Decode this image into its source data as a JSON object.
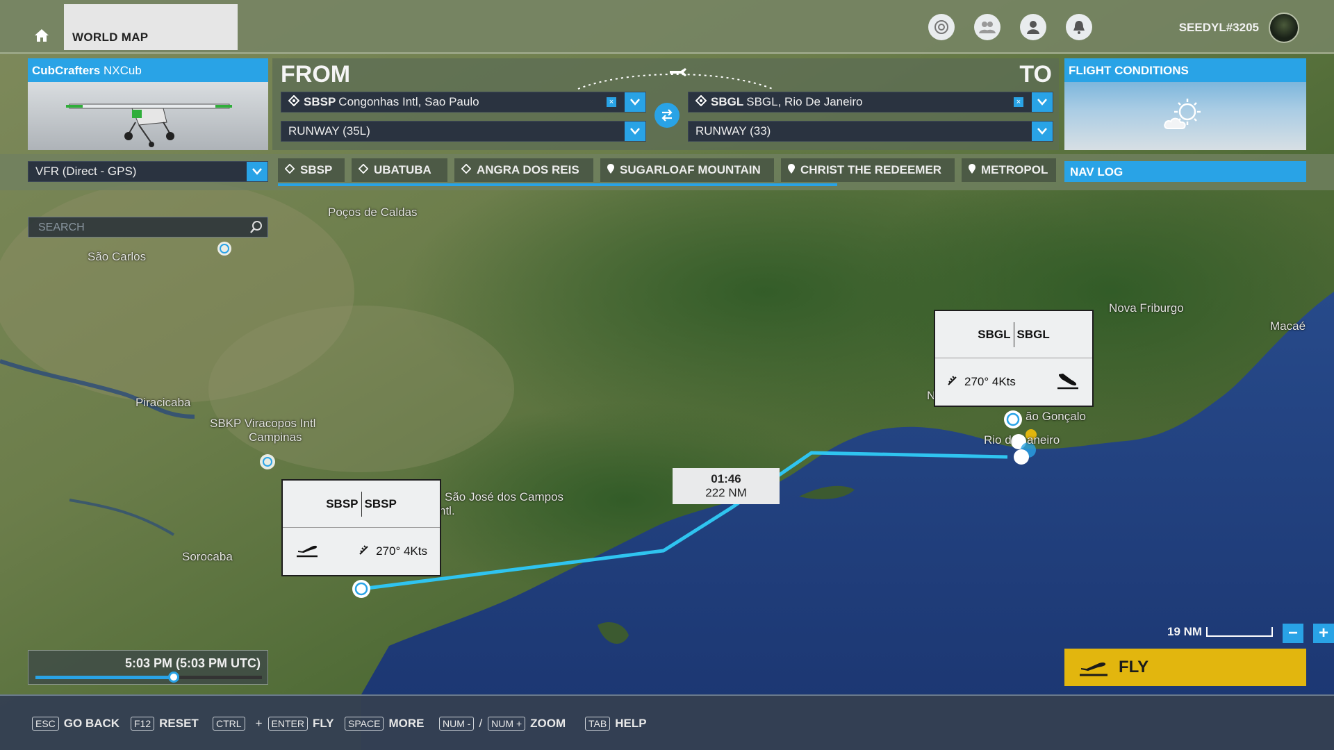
{
  "topbar": {
    "tab_label": "WORLD MAP",
    "username": "SEEDYL#3205",
    "icons": [
      "achievements-icon",
      "friends-icon",
      "profile-icon",
      "notifications-icon"
    ]
  },
  "aircraft": {
    "brand": "CubCrafters",
    "model": "NXCub"
  },
  "route": {
    "from_label": "FROM",
    "to_label": "TO",
    "from_code": "SBSP",
    "from_name": "Congonhas Intl, Sao Paulo",
    "from_runway": "RUNWAY (35L)",
    "to_code": "SBGL",
    "to_name": "SBGL, Rio De Janeiro",
    "to_runway": "RUNWAY (33)",
    "clear_glyph": "×"
  },
  "conditions": {
    "title": "FLIGHT CONDITIONS"
  },
  "flight_type": "VFR (Direct - GPS)",
  "waypoints": [
    {
      "label": "SBSP",
      "icon": "airport-icon"
    },
    {
      "label": "UBATUBA",
      "icon": "airport-icon"
    },
    {
      "label": "ANGRA DOS REIS",
      "icon": "airport-icon"
    },
    {
      "label": "SUGARLOAF MOUNTAIN",
      "icon": "pin-icon"
    },
    {
      "label": "CHRIST THE REDEEMER",
      "icon": "pin-icon"
    },
    {
      "label": "METROPOL",
      "icon": "pin-icon"
    }
  ],
  "navlog": "NAV LOG",
  "search": {
    "placeholder": "SEARCH"
  },
  "map_labels": {
    "pocos": "Poços de Caldas",
    "sao_carlos": "São Carlos",
    "piracicaba": "Piracicaba",
    "sbkp": "SBKP Viracopos Intl",
    "campinas": "Campinas",
    "sao_jose": "São José dos Campos",
    "intl": "ntl.",
    "sorocaba": "Sorocaba",
    "nova_friburgo": "Nova Friburgo",
    "macae": "Macaé",
    "sao_goncalo": "ão Gonçalo",
    "rio": "Rio d",
    "rio2": "aneiro",
    "n": "N"
  },
  "cards": {
    "departure": {
      "code_a": "SBSP",
      "code_b": "SBSP",
      "wind": "270° 4Kts"
    },
    "arrival": {
      "code_a": "SBGL",
      "code_b": "SBGL",
      "wind": "270° 4Kts"
    }
  },
  "leg": {
    "time": "01:46",
    "distance": "222 NM"
  },
  "time_of_day": {
    "label": "5:03 PM (5:03 PM UTC)",
    "fraction": 0.61
  },
  "scale": {
    "label": "19 NM"
  },
  "zoom": {
    "minus": "−",
    "plus": "+"
  },
  "fly_label": "FLY",
  "shortcuts": [
    {
      "keys": [
        "ESC"
      ],
      "label": "GO BACK"
    },
    {
      "keys": [
        "F12"
      ],
      "label": "RESET"
    },
    {
      "keys": [
        "CTRL",
        "ENTER"
      ],
      "sep": "+",
      "label": "FLY"
    },
    {
      "keys": [
        "SPACE"
      ],
      "label": "MORE"
    },
    {
      "keys": [
        "NUM -",
        "NUM +"
      ],
      "sep": "/",
      "label": "ZOOM"
    },
    {
      "keys": [
        "TAB"
      ],
      "label": "HELP"
    }
  ],
  "colors": {
    "accent": "#29a3e6",
    "fly": "#e2b60e",
    "route": "#2fc4f0"
  }
}
